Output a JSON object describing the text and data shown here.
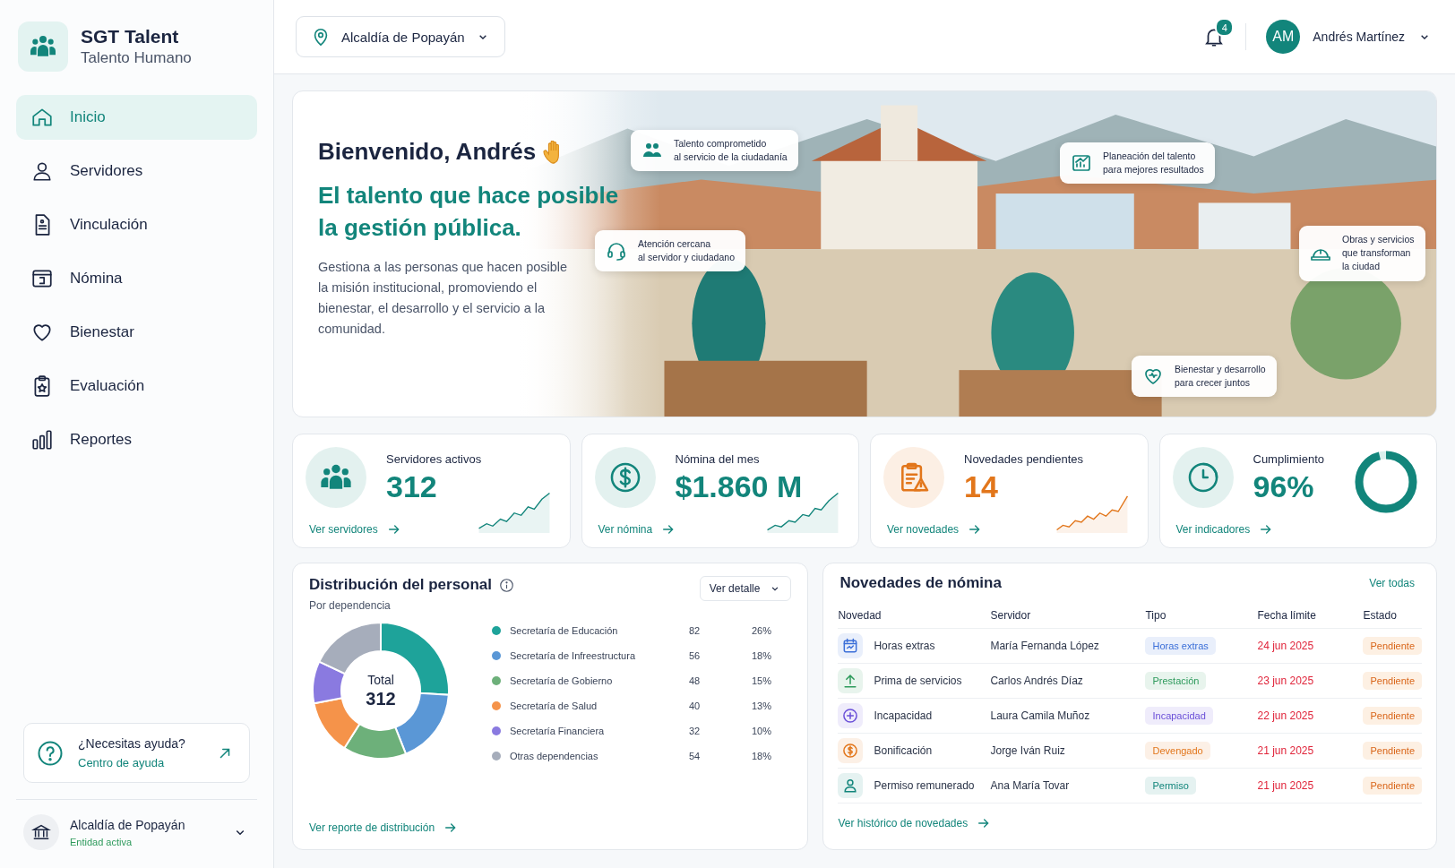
{
  "brand": {
    "name": "SGT Talent",
    "subtitle": "Talento Humano"
  },
  "nav": [
    {
      "label": "Inicio",
      "selected": true
    },
    {
      "label": "Servidores",
      "selected": false
    },
    {
      "label": "Vinculación",
      "selected": false
    },
    {
      "label": "Nómina",
      "selected": false
    },
    {
      "label": "Bienestar",
      "selected": false
    },
    {
      "label": "Evaluación",
      "selected": false
    },
    {
      "label": "Reportes",
      "selected": false
    }
  ],
  "help": {
    "title": "¿Necesitas ayuda?",
    "link": "Centro de ayuda"
  },
  "entity": {
    "name": "Alcaldía de Popayán",
    "status": "Entidad activa"
  },
  "header": {
    "location": "Alcaldía de Popayán",
    "notifications": "4",
    "user_initials": "AM",
    "user_name": "Andrés Martínez"
  },
  "hero": {
    "greeting": "Bienvenido, Andrés",
    "headline": "El talento que hace posible la gestión pública.",
    "description": "Gestiona a las personas que hacen posible la misión institucional, promoviendo el bienestar, el desarrollo y el servicio a la comunidad.",
    "callouts": [
      {
        "text": "Talento comprometido\nal servicio de la ciudadanía"
      },
      {
        "text": "Planeación del talento\npara mejores resultados"
      },
      {
        "text": "Atención cercana\nal servidor y ciudadano"
      },
      {
        "text": "Obras y servicios\nque transforman\nla ciudad"
      },
      {
        "text": "Bienestar y desarrollo\npara crecer juntos"
      }
    ]
  },
  "stats": [
    {
      "kind": "sparkline",
      "label": "Servidores activos",
      "value": "312",
      "link": "Ver servidores",
      "color": "#12857b"
    },
    {
      "kind": "sparkline",
      "label": "Nómina del mes",
      "value": "$1.860 M",
      "link": "Ver nómina",
      "color": "#12857b"
    },
    {
      "kind": "sparkline",
      "label": "Novedades pendientes",
      "value": "14",
      "link": "Ver novedades",
      "color": "#e2761b"
    },
    {
      "kind": "ring",
      "label": "Cumplimiento",
      "value": "96%",
      "link": "Ver indicadores",
      "color": "#12857b",
      "level": 0.96
    }
  ],
  "distribution": {
    "title": "Distribución del personal",
    "subtitle": "Por dependencia",
    "filter": "Ver detalle",
    "total_label": "Total",
    "total_value": "312",
    "link": "Ver reporte de distribución",
    "legend": [
      {
        "count": "82",
        "percent": "26%",
        "color": "#1ea39a"
      },
      {
        "count": "56",
        "percent": "18%",
        "color": "#5a97d6"
      },
      {
        "count": "48",
        "percent": "15%",
        "color": "#6db07a"
      },
      {
        "count": "40",
        "percent": "13%",
        "color": "#f5934a"
      },
      {
        "count": "32",
        "percent": "10%",
        "color": "#8a7ae0"
      },
      {
        "count": "54",
        "percent": "18%",
        "color": "#a6adbb"
      }
    ],
    "chart_data": {
      "type": "donut",
      "categories": [
        "Secretaría de Educación",
        "Secretaría de Infreestructura",
        "Secretaría de Gobierno",
        "Secretaría de Salud",
        "Secretaría Financiera",
        "Otras dependencias"
      ],
      "values": [
        26,
        18,
        15,
        13,
        10,
        18
      ]
    }
  },
  "payroll": {
    "title": "Novedades de nómina",
    "view_all": "Ver todas",
    "columns": [
      "Novedad",
      "Servidor",
      "Tipo",
      "Fecha límite",
      "Estado"
    ],
    "rows": [
      {
        "color": "#3b6fd8",
        "novedad": "Horas extras",
        "servidor": "María Fernanda López",
        "tipo": "Horas extras",
        "fecha": "24 jun 2025",
        "estado": "Pendiente"
      },
      {
        "color": "#2e9a5c",
        "novedad": "Prima de servicios",
        "servidor": "Carlos Andrés Díaz",
        "tipo": "Prestación",
        "fecha": "23 jun 2025",
        "estado": "Pendiente"
      },
      {
        "color": "#6a4fd8",
        "novedad": "Incapacidad",
        "servidor": "Laura Camila Muñoz",
        "tipo": "Incapacidad",
        "fecha": "22 jun 2025",
        "estado": "Pendiente"
      },
      {
        "color": "#e2761b",
        "novedad": "Bonificación",
        "servidor": "Jorge Iván Ruiz",
        "tipo": "Devengado",
        "fecha": "21 jun 2025",
        "estado": "Pendiente"
      },
      {
        "color": "#12857b",
        "novedad": "Permiso remunerado",
        "servidor": "Ana María Tovar",
        "tipo": "Permiso",
        "fecha": "21 jun 2025",
        "estado": "Pendiente"
      }
    ],
    "link": "Ver histórico de novedades"
  }
}
